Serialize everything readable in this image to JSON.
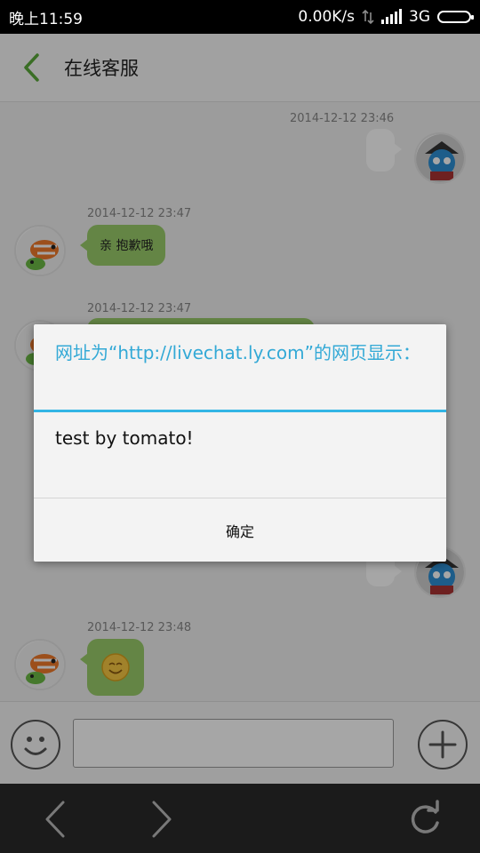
{
  "status_bar": {
    "time": "晚上11:59",
    "net_speed": "0.00K/s",
    "network": "3G"
  },
  "header": {
    "title": "在线客服"
  },
  "messages": [
    {
      "timestamp": "2014-12-12 23:46",
      "side": "right"
    },
    {
      "timestamp": "2014-12-12 23:47",
      "side": "left",
      "text": "亲 抱歉哦"
    },
    {
      "timestamp": "2014-12-12 23:47",
      "side": "left"
    },
    {
      "timestamp": "2014-12-12 23:48",
      "side": "left",
      "content": "smiley-emoji"
    }
  ],
  "input": {
    "value": "",
    "placeholder": ""
  },
  "dialog": {
    "title": "网址为“http://livechat.ly.com”的网页显示：",
    "message": "test by tomato!",
    "button_label": "确定"
  },
  "colors": {
    "accent": "#33b5e5",
    "bubble_green": "#9acd6b",
    "back_arrow": "#5aaa3a"
  },
  "icons": [
    "back-arrow-icon",
    "emoji-icon",
    "plus-icon",
    "nav-back-icon",
    "nav-forward-icon",
    "refresh-icon"
  ]
}
